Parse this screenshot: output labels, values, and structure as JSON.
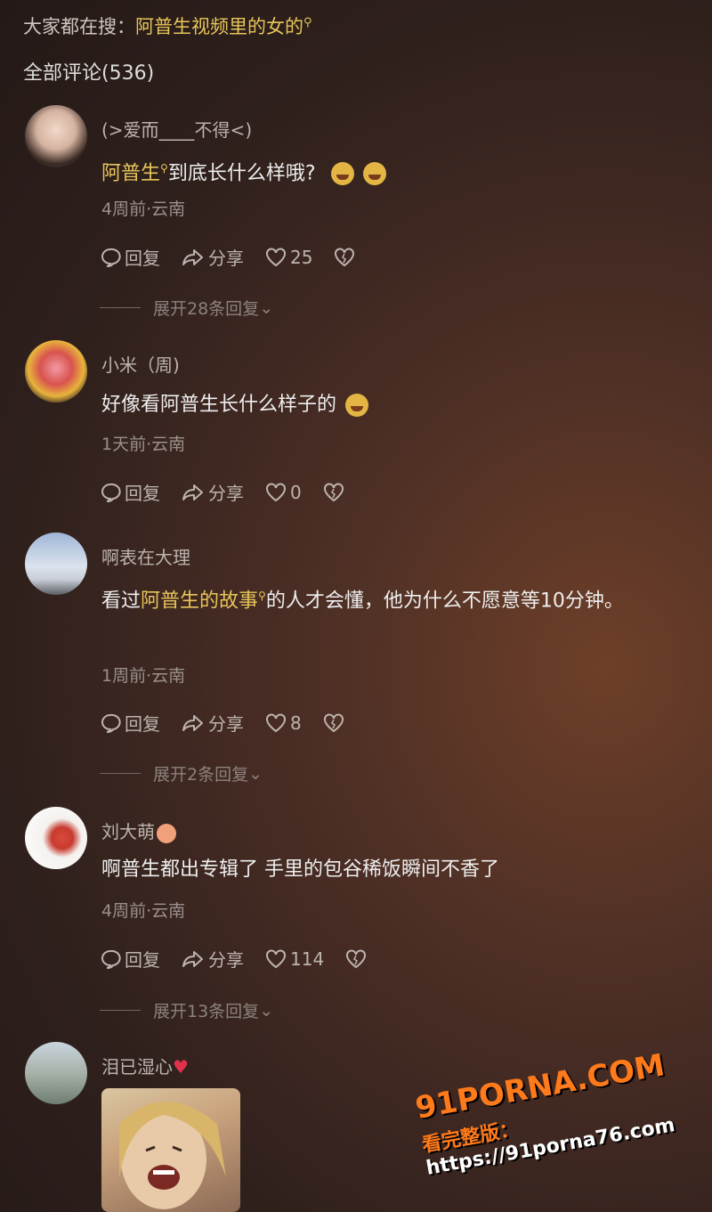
{
  "search": {
    "prefix": "大家都在搜：",
    "term": "阿普生视频里的女的"
  },
  "comments_count": "全部评论(536)",
  "comments": [
    {
      "user": "(>爱而⎽⎽不得<)",
      "text_hl": "阿普生",
      "text_rest": "到底长什么样哦?",
      "meta": "4周前·云南",
      "reply": "回复",
      "share": "分享",
      "likes": "25",
      "expand": "展开28条回复"
    },
    {
      "user": "小米（周)",
      "text": "好像看阿普生长什么样子的",
      "meta": "1天前·云南",
      "reply": "回复",
      "share": "分享",
      "likes": "0"
    },
    {
      "user": "啊表在大理",
      "text_pre": "看过",
      "text_hl": "阿普生的故事",
      "text_rest": "的人才会懂，他为什么不愿意等10分钟。",
      "meta": "1周前·云南",
      "reply": "回复",
      "share": "分享",
      "likes": "8",
      "expand": "展开2条回复"
    },
    {
      "user": "刘大萌",
      "text": "啊普生都出专辑了  手里的包谷稀饭瞬间不香了",
      "meta": "4周前·云南",
      "reply": "回复",
      "share": "分享",
      "likes": "114",
      "expand": "展开13条回复"
    },
    {
      "user": "泪已湿心"
    }
  ],
  "watermark": {
    "line1": "91PORNA.COM",
    "line2_cn": "看完整版：",
    "line2_url": "https://91porna76.com"
  },
  "colors": {
    "highlight": "#e7c55a",
    "watermark": "#ff7a1a"
  }
}
